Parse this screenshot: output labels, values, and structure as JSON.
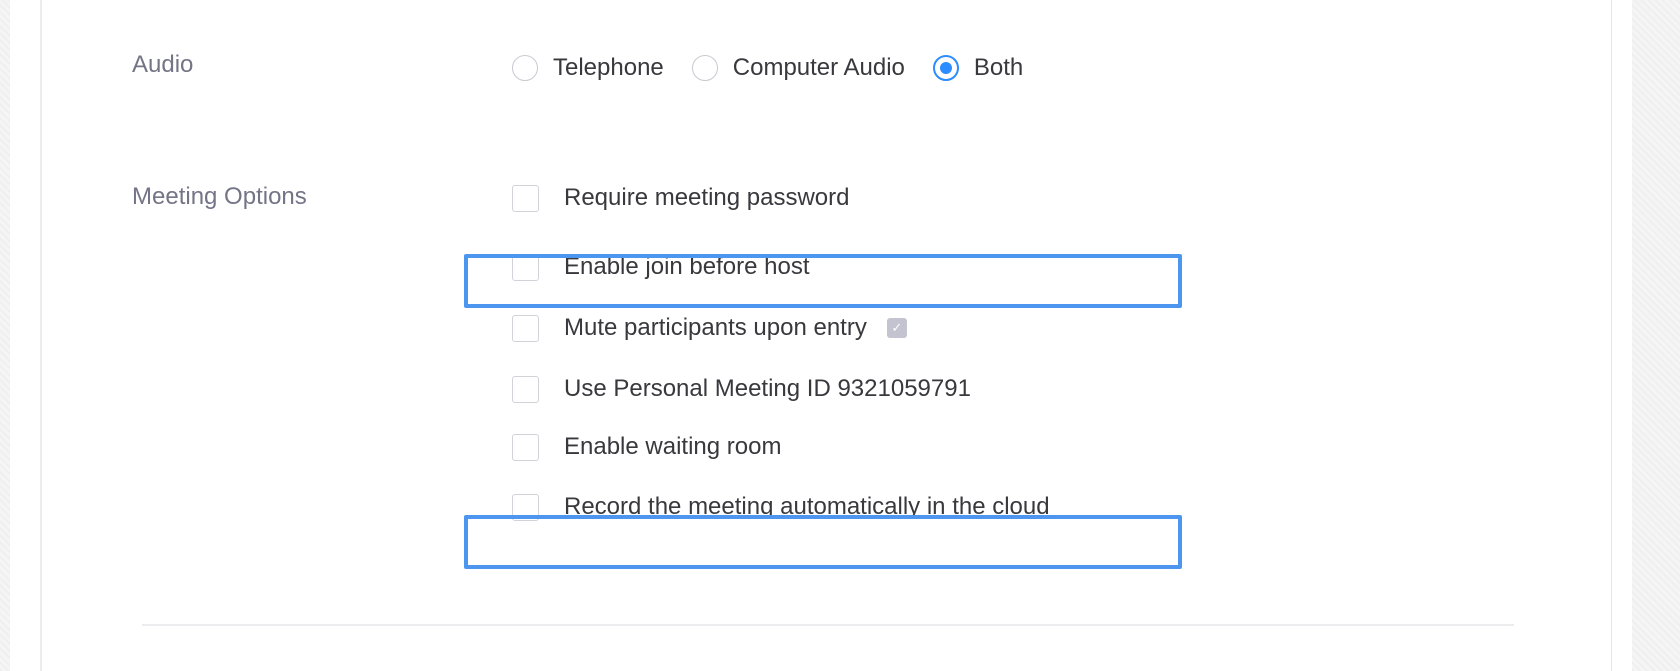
{
  "audio": {
    "label": "Audio",
    "options": [
      {
        "label": "Telephone",
        "selected": false
      },
      {
        "label": "Computer Audio",
        "selected": false
      },
      {
        "label": "Both",
        "selected": true
      }
    ]
  },
  "meeting_options": {
    "label": "Meeting Options",
    "items": [
      {
        "label": "Require meeting password",
        "checked": false
      },
      {
        "label": "Enable join before host",
        "checked": false,
        "highlighted": true
      },
      {
        "label": "Mute participants upon entry",
        "checked": false
      },
      {
        "label": "Use Personal Meeting ID 9321059791",
        "checked": false
      },
      {
        "label": "Enable waiting room",
        "checked": false
      },
      {
        "label": "Record the meeting automatically in the cloud",
        "checked": false,
        "highlighted": true
      }
    ]
  },
  "colors": {
    "accent": "#2d8cff",
    "highlight": "#4c96f0",
    "label_text": "#747487",
    "body_text": "#38383d"
  },
  "icons": {
    "mute_info": "info-icon"
  }
}
